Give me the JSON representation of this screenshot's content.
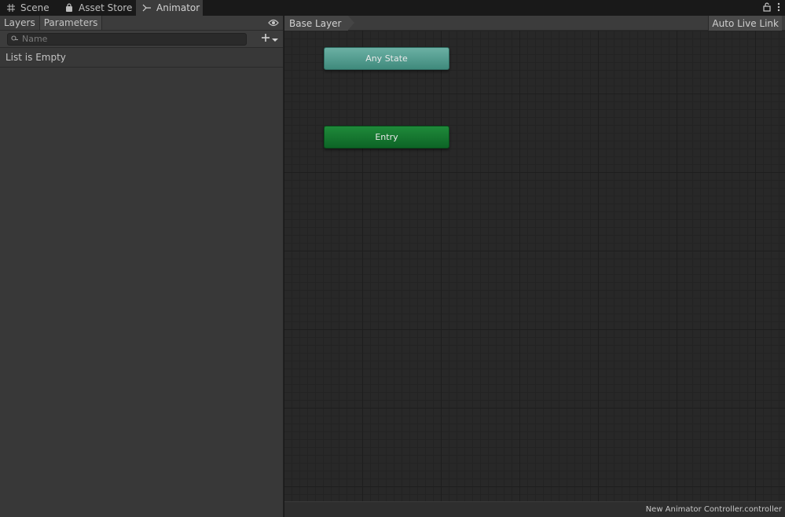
{
  "tabs": [
    {
      "label": "Scene",
      "icon": "grid-icon",
      "active": false
    },
    {
      "label": "Asset Store",
      "icon": "bag-icon",
      "active": false
    },
    {
      "label": "Animator",
      "icon": "animator-icon",
      "active": true
    }
  ],
  "left_panel": {
    "tabs": [
      "Layers",
      "Parameters"
    ],
    "active_tab": "Parameters",
    "search": {
      "placeholder": "Name",
      "value": ""
    },
    "empty_message": "List is Empty"
  },
  "graph": {
    "breadcrumb": "Base Layer",
    "auto_live_link": "Auto Live Link",
    "nodes": [
      {
        "label": "Any State",
        "color": "#5fa397"
      },
      {
        "label": "Entry",
        "color": "#137a30"
      }
    ]
  },
  "status": {
    "file": "New Animator Controller.controller"
  },
  "colors": {
    "panel": "#383838",
    "graph_bg": "#282828",
    "any_state": "#5fa397",
    "entry": "#137a30"
  }
}
